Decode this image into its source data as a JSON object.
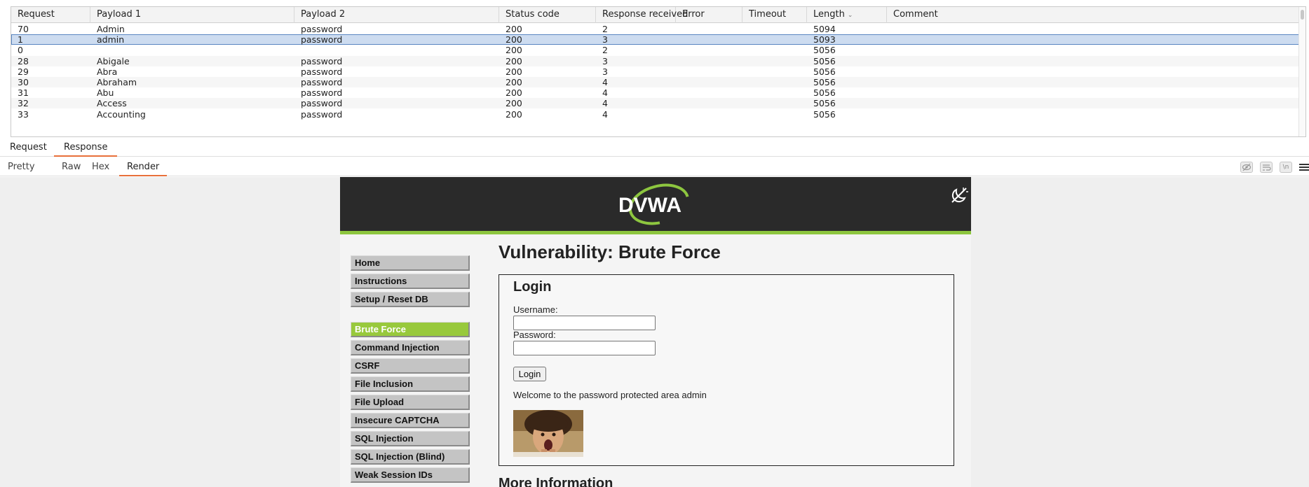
{
  "table": {
    "columns": [
      "Request",
      "Payload 1",
      "Payload 2",
      "Status code",
      "Response received",
      "Error",
      "Timeout",
      "Length",
      "Comment"
    ],
    "sorted_column": "Length",
    "rows": [
      {
        "request": "70",
        "payload1": "Admin",
        "payload2": "password",
        "status": "200",
        "received": "2",
        "error": "",
        "timeout": "",
        "length": "5094",
        "comment": ""
      },
      {
        "request": "1",
        "payload1": "admin",
        "payload2": "password",
        "status": "200",
        "received": "3",
        "error": "",
        "timeout": "",
        "length": "5093",
        "comment": ""
      },
      {
        "request": "0",
        "payload1": "",
        "payload2": "",
        "status": "200",
        "received": "2",
        "error": "",
        "timeout": "",
        "length": "5056",
        "comment": ""
      },
      {
        "request": "28",
        "payload1": "Abigale",
        "payload2": "password",
        "status": "200",
        "received": "3",
        "error": "",
        "timeout": "",
        "length": "5056",
        "comment": ""
      },
      {
        "request": "29",
        "payload1": "Abra",
        "payload2": "password",
        "status": "200",
        "received": "3",
        "error": "",
        "timeout": "",
        "length": "5056",
        "comment": ""
      },
      {
        "request": "30",
        "payload1": "Abraham",
        "payload2": "password",
        "status": "200",
        "received": "4",
        "error": "",
        "timeout": "",
        "length": "5056",
        "comment": ""
      },
      {
        "request": "31",
        "payload1": "Abu",
        "payload2": "password",
        "status": "200",
        "received": "4",
        "error": "",
        "timeout": "",
        "length": "5056",
        "comment": ""
      },
      {
        "request": "32",
        "payload1": "Access",
        "payload2": "password",
        "status": "200",
        "received": "4",
        "error": "",
        "timeout": "",
        "length": "5056",
        "comment": ""
      },
      {
        "request": "33",
        "payload1": "Accounting",
        "payload2": "password",
        "status": "200",
        "received": "4",
        "error": "",
        "timeout": "",
        "length": "5056",
        "comment": ""
      }
    ]
  },
  "tabs": {
    "request": "Request",
    "response": "Response"
  },
  "subtabs": {
    "pretty": "Pretty",
    "raw": "Raw",
    "hex": "Hex",
    "render": "Render"
  },
  "icons": {
    "hide": "eye-off-icon",
    "wrap": "wrap-lines-icon",
    "newline": "\\n",
    "menu": "hamburger-icon"
  },
  "dvwa": {
    "logo_text": "DVWA",
    "page_title": "Vulnerability: Brute Force",
    "nav": {
      "home": "Home",
      "instructions": "Instructions",
      "setup": "Setup / Reset DB",
      "brute_force": "Brute Force",
      "command_injection": "Command Injection",
      "csrf": "CSRF",
      "file_inclusion": "File Inclusion",
      "file_upload": "File Upload",
      "insecure_captcha": "Insecure CAPTCHA",
      "sql_injection": "SQL Injection",
      "sql_injection_blind": "SQL Injection (Blind)",
      "weak_session_ids": "Weak Session IDs"
    },
    "login": {
      "title": "Login",
      "username_label": "Username:",
      "username_value": "",
      "password_label": "Password:",
      "password_value": "",
      "button": "Login",
      "welcome": "Welcome to the password protected area admin"
    },
    "more_info": "More Information"
  },
  "colors": {
    "accent_tab": "#e8703a",
    "selection": "#cddcf0",
    "dvwa_green": "#8dc63f",
    "dvwa_header": "#2a2a2a"
  }
}
